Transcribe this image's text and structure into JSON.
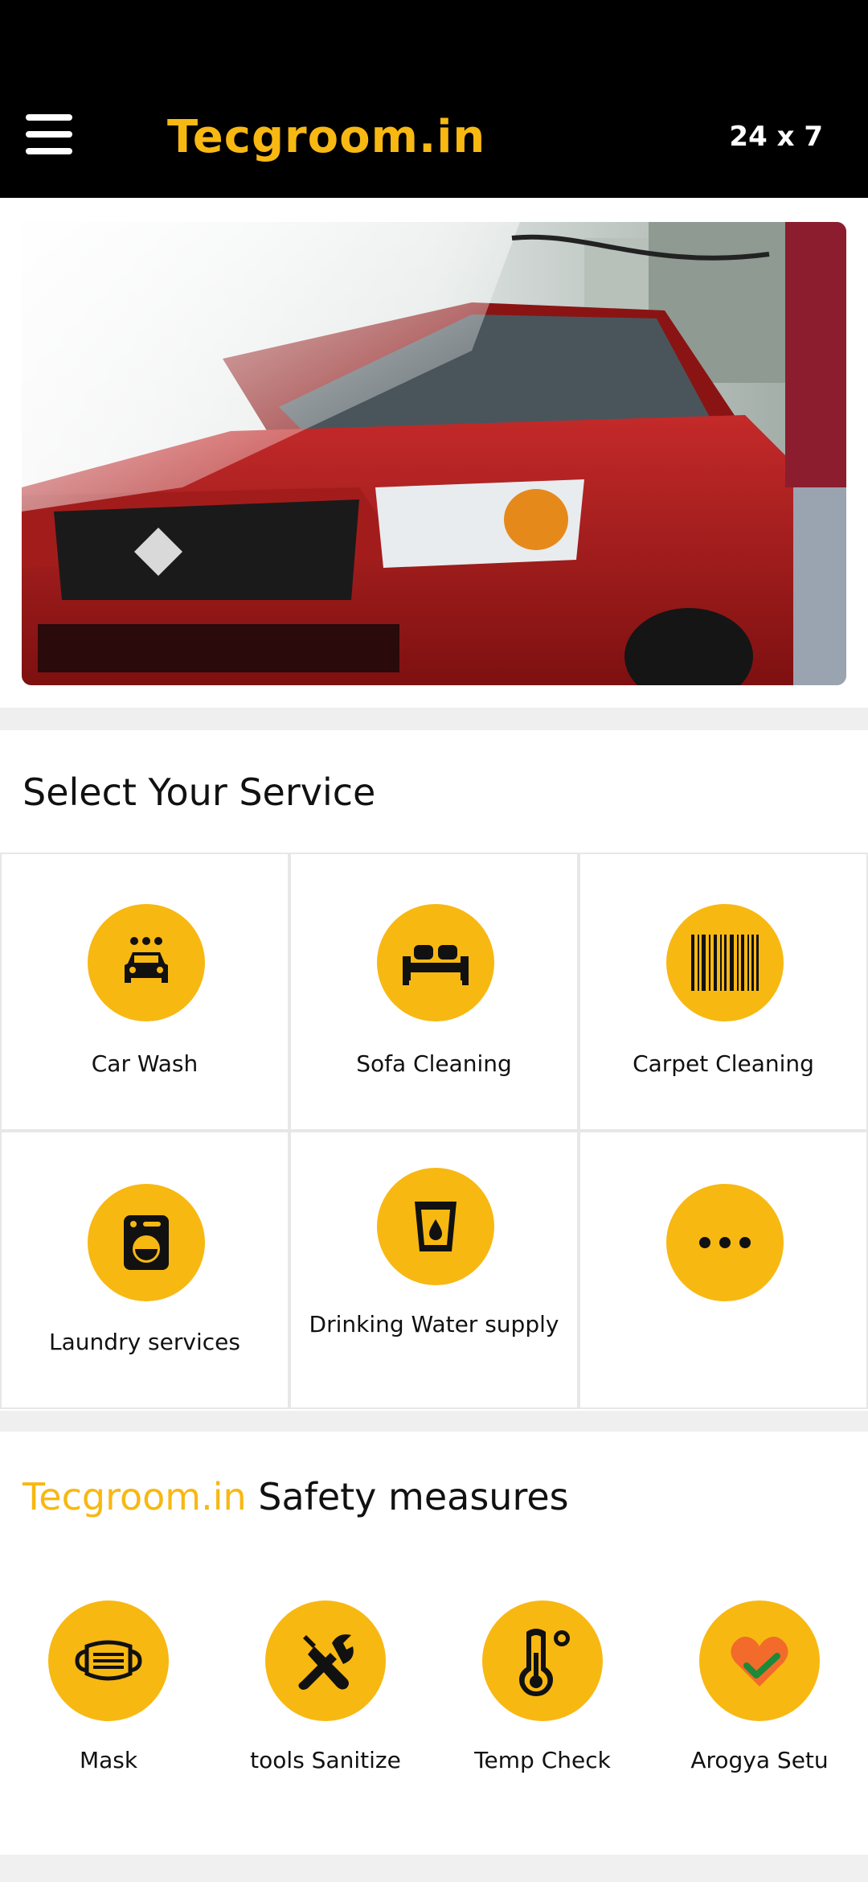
{
  "header": {
    "brand": "Tecgroom.in",
    "hours": "24 x 7",
    "menu_icon": "hamburger-menu-icon"
  },
  "hero": {
    "icon": "car-wash-photo"
  },
  "services": {
    "title": "Select Your Service",
    "items": [
      {
        "label": "Car Wash",
        "icon": "car-wash-icon"
      },
      {
        "label": "Sofa Cleaning",
        "icon": "sofa-icon"
      },
      {
        "label": "Carpet Cleaning",
        "icon": "barcode-icon"
      },
      {
        "label": "Laundry services",
        "icon": "washing-machine-icon"
      },
      {
        "label": "Drinking Water supply",
        "icon": "water-glass-icon"
      },
      {
        "label": "",
        "icon": "more-dots-icon"
      }
    ]
  },
  "safety": {
    "brand": "Tecgroom.in",
    "title": "Safety measures",
    "items": [
      {
        "label": "Mask",
        "icon": "mask-icon"
      },
      {
        "label": "tools Sanitize",
        "icon": "tools-icon"
      },
      {
        "label": "Temp Check",
        "icon": "thermometer-icon"
      },
      {
        "label": "Arogya Setu",
        "icon": "heart-check-icon"
      }
    ]
  },
  "colors": {
    "accent": "#f8b812",
    "appbar": "#000000",
    "divider": "#efefef"
  }
}
